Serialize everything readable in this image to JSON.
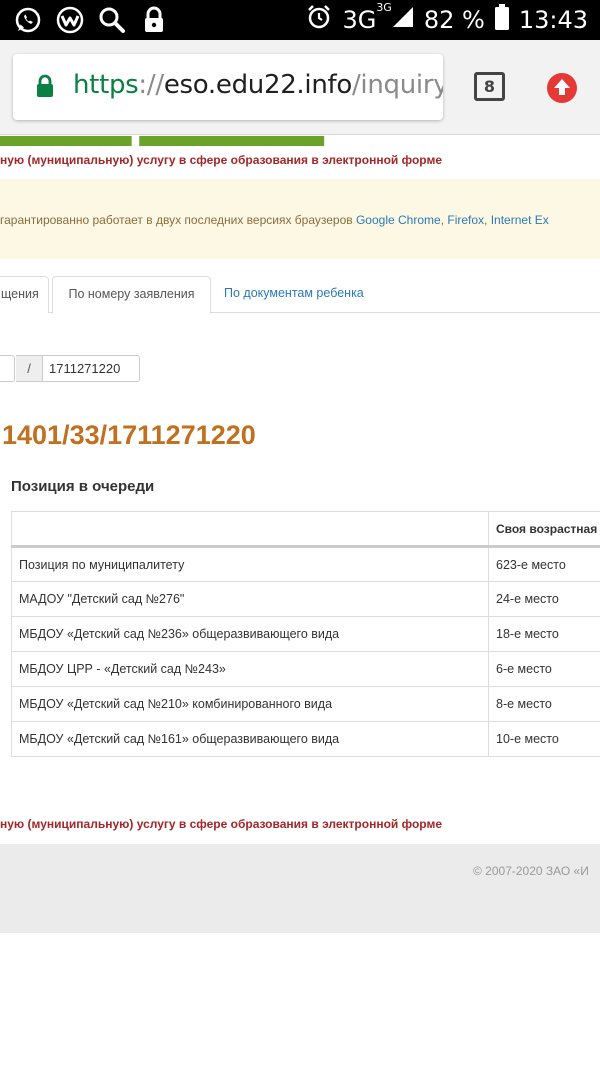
{
  "status_bar": {
    "network": "3G",
    "network_sup": "3G",
    "battery": "82 %",
    "time": "13:43"
  },
  "browser": {
    "url_scheme": "https",
    "url_sep": "://",
    "url_host": "eso.edu22.info",
    "url_path": "/inquiry",
    "tab_count": "8",
    "colors": {
      "secure": "#0b8043",
      "upload": "#e53935"
    }
  },
  "page": {
    "subtitle": "ную (муниципальную) услугу в сфере образования в электронной форме",
    "notice": {
      "text": "гарантированно работает в двух последних версиях браузеров ",
      "link_chrome": "Google Chrome",
      "sep1": ", ",
      "link_firefox": "Firefox",
      "sep2": ", ",
      "link_ie": "Internet Ex"
    },
    "tabs": [
      {
        "label": "щения"
      },
      {
        "label": "По номеру заявления"
      },
      {
        "label": "По документам ребенка"
      }
    ],
    "search": {
      "separator": "/",
      "number_value": "1711271220"
    },
    "application_number": "1401/33/1711271220",
    "queue_title": "Позиция в очереди",
    "queue_table": {
      "headers": [
        "",
        "Своя возрастная"
      ],
      "rows": [
        [
          "Позиция по муниципалитету",
          "623-е место"
        ],
        [
          "МАДОУ \"Детский сад №276\"",
          "24-е место"
        ],
        [
          "МБДОУ «Детский сад №236» общеразвивающего вида",
          "18-е место"
        ],
        [
          "МБДОУ ЦРР - «Детский сад №243»",
          "6-е место"
        ],
        [
          "МБДОУ «Детский сад №210» комбинированного вида",
          "8-е место"
        ],
        [
          "МБДОУ «Детский сад №161» общеразвивающего вида",
          "10-е место"
        ]
      ]
    },
    "footer_subtitle": "ную (муниципальную) услугу в сфере образования в электронной форме",
    "copyright": "© 2007-2020 ЗАО «И"
  }
}
